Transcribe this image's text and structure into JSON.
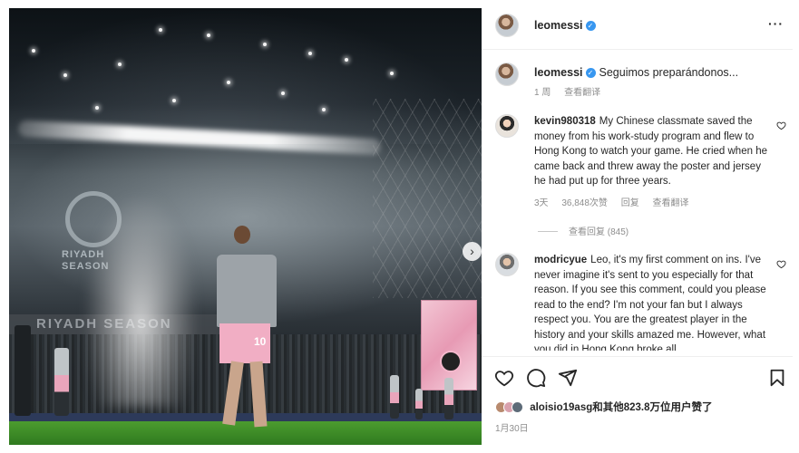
{
  "post": {
    "author": "leomessi",
    "more_icon": "more-horizontal-icon",
    "caption": {
      "username": "leomessi",
      "text": "Seguimos preparándonos...",
      "time": "1 周",
      "translate": "查看翻译"
    },
    "photo": {
      "riyadh_text": "RIYADH\nSEASON",
      "board_text": "RIYADH SEASON",
      "shorts_number": "10",
      "next_icon": "chevron-right-icon"
    }
  },
  "comments": [
    {
      "username": "kevin980318",
      "text": "My Chinese classmate saved the money from his work-study program and flew to Hong Kong to watch your game. He cried when he came back and threw away the poster and jersey he had put up for three years.",
      "time": "3天",
      "likes": "36,848次赞",
      "reply": "回复",
      "translate": "查看翻译",
      "view_replies": "查看回复 (845)"
    },
    {
      "username": "modricyue",
      "text": "Leo, it's my first comment on ins. I've never imagine it's sent to you especially for that reason. If you see this comment, could you please read to the end? I'm not your fan but I always respect you. You are the greatest player in the history and your skills amazed me. However, what you did in Hong Kong broke all"
    }
  ],
  "actions": {
    "like_icon": "heart-icon",
    "comment_icon": "comment-icon",
    "share_icon": "send-icon",
    "save_icon": "bookmark-icon"
  },
  "likes": {
    "text": "aloisio19asg和其他823.8万位用户赞了"
  },
  "date": "1月30日"
}
